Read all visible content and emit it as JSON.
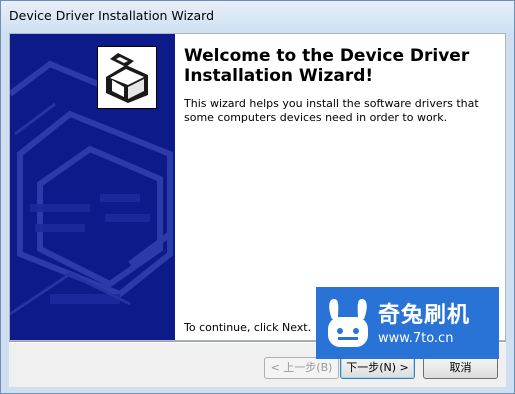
{
  "window": {
    "title": "Device Driver Installation Wizard"
  },
  "main": {
    "heading": "Welcome to the Device Driver Installation Wizard!",
    "description": "This wizard helps you install the software drivers that some computers devices need in order to work.",
    "continue_text": "To continue, click Next."
  },
  "buttons": {
    "back": "< 上一步(B)",
    "next": "下一步(N) >",
    "cancel": "取消"
  },
  "watermark": {
    "title": "奇兔刷机",
    "url": "www.7to.cn"
  },
  "icons": {
    "wizard": "driver-box-icon",
    "watermark_logo": "rabbit-logo-icon"
  },
  "colors": {
    "panel_blue": "#0d1a8a",
    "watermark_blue": "#2a73d6"
  }
}
